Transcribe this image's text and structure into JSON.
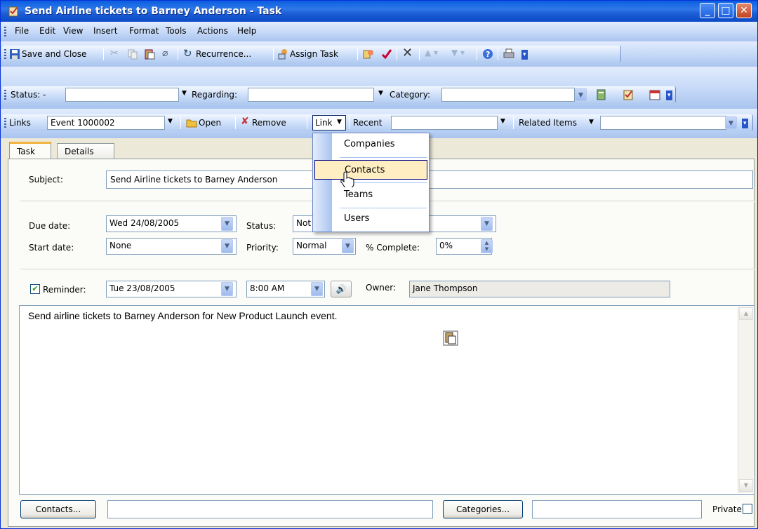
{
  "window": {
    "title": "Send Airline tickets to Barney Anderson - Task"
  },
  "menubar": [
    "File",
    "Edit",
    "View",
    "Insert",
    "Format",
    "Tools",
    "Actions",
    "Help"
  ],
  "standard_toolbar": {
    "save_close": "Save and Close",
    "recurrence": "Recurrence...",
    "assign_task": "Assign Task"
  },
  "crm_toolbar": {
    "status_label": "Status:",
    "status_value": "-",
    "regarding_label": "Regarding:",
    "category_label": "Category:"
  },
  "links_toolbar": {
    "links_label": "Links",
    "event_value": "Event 1000002",
    "open": "Open",
    "remove": "Remove",
    "link": "Link",
    "recent": "Recent",
    "related_items": "Related Items"
  },
  "tabs": [
    "Task",
    "Details"
  ],
  "form": {
    "subject_label": "Subject:",
    "subject_value": "Send Airline tickets to Barney Anderson",
    "due_label": "Due date:",
    "due_value": "Wed 24/08/2005",
    "status_label": "Status:",
    "status_value": "Not",
    "start_label": "Start date:",
    "start_value": "None",
    "priority_label": "Priority:",
    "priority_value": "Normal",
    "complete_label": "% Complete:",
    "complete_value": "0%",
    "reminder_label": "Reminder:",
    "reminder_date": "Tue 23/08/2005",
    "reminder_time": "8:00 AM",
    "owner_label": "Owner:",
    "owner_value": "Jane Thompson",
    "body": "Send airline tickets to Barney Anderson for New Product Launch event."
  },
  "footer": {
    "contacts": "Contacts...",
    "categories": "Categories...",
    "private": "Private"
  },
  "link_menu": [
    "Companies",
    "Contacts",
    "Teams",
    "Users"
  ]
}
